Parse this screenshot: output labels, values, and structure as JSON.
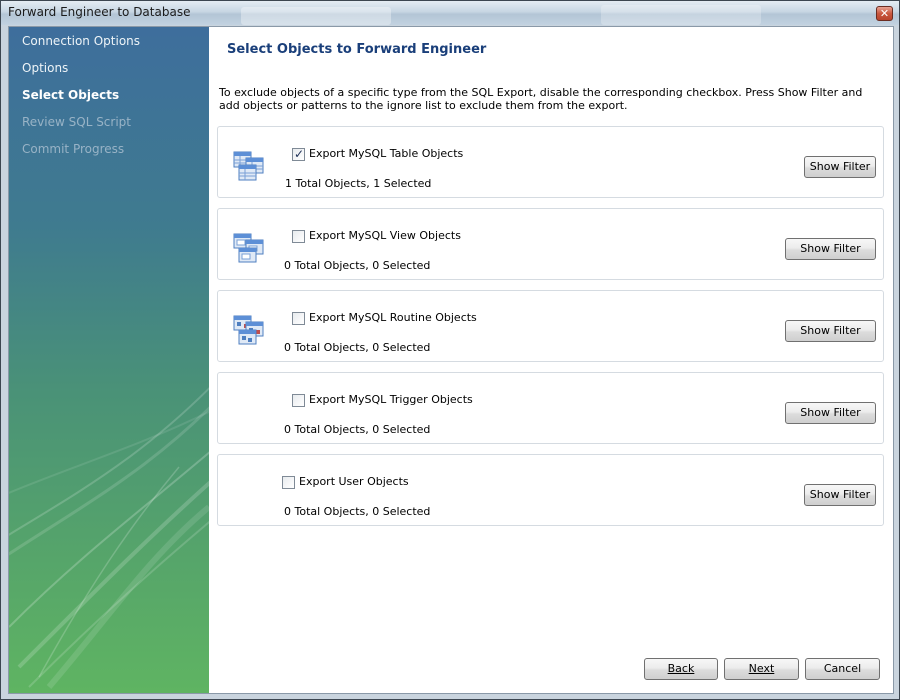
{
  "window": {
    "title": "Forward Engineer to Database",
    "close_glyph": "✕"
  },
  "sidebar": {
    "items": [
      {
        "label": "Connection Options",
        "state": "normal"
      },
      {
        "label": "Options",
        "state": "normal"
      },
      {
        "label": "Select Objects",
        "state": "active"
      },
      {
        "label": "Review SQL Script",
        "state": "disabled"
      },
      {
        "label": "Commit Progress",
        "state": "disabled"
      }
    ]
  },
  "main": {
    "heading": "Select Objects to Forward Engineer",
    "description": "To exclude objects of a specific type from the SQL Export, disable the corresponding checkbox. Press Show Filter and add objects or patterns to the ignore list to exclude them from the export.",
    "groups": [
      {
        "label": "Export MySQL Table Objects",
        "checked": true,
        "count": "1 Total Objects, 1 Selected",
        "button": "Show Filter",
        "icon": "table-objects-icon"
      },
      {
        "label": "Export MySQL View Objects",
        "checked": false,
        "count": "0 Total Objects, 0 Selected",
        "button": "Show Filter",
        "icon": "view-objects-icon"
      },
      {
        "label": "Export MySQL Routine Objects",
        "checked": false,
        "count": "0 Total Objects, 0 Selected",
        "button": "Show Filter",
        "icon": "routine-objects-icon"
      },
      {
        "label": "Export MySQL Trigger Objects",
        "checked": false,
        "count": "0 Total Objects, 0 Selected",
        "button": "Show Filter",
        "icon": ""
      },
      {
        "label": "Export User Objects",
        "checked": false,
        "count": "0 Total Objects, 0 Selected",
        "button": "Show Filter",
        "icon": ""
      }
    ]
  },
  "footer": {
    "back": "Back",
    "next": "Next",
    "cancel": "Cancel"
  },
  "colors": {
    "heading": "#1a3f7a",
    "sidebar_top": "#3e6e9c",
    "sidebar_bottom": "#5fb462"
  }
}
